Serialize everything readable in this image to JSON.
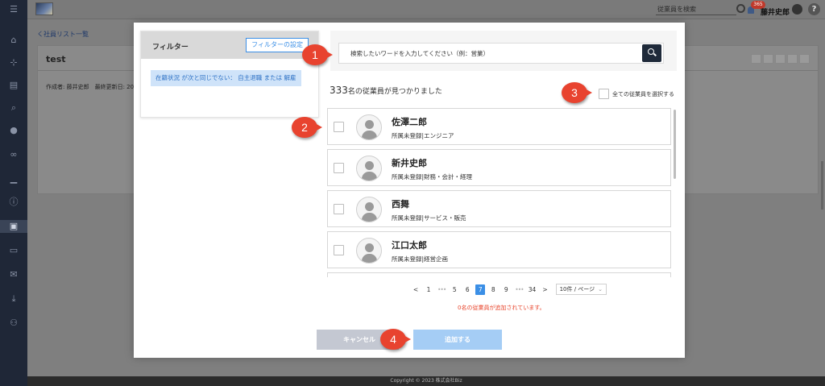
{
  "topbar": {
    "search_placeholder": "従業員を検索",
    "notification_count": "365",
    "user_name": "藤井史郎",
    "help_label": "?"
  },
  "background": {
    "back_link": "く社員リスト一覧",
    "page_title": "test",
    "meta": "作成者: 藤井史郎　最終更新日: 20",
    "footer": "Copyright © 2023 株式会社Biz"
  },
  "modal": {
    "filter": {
      "title": "フィルター",
      "setting_button": "フィルターの設定",
      "chip": "在籍状況 が次と同じでない： 自主退職 または 解雇"
    },
    "search": {
      "placeholder": "検索したいワードを入力してください（例：営業）"
    },
    "result": {
      "count": "333",
      "suffix": "名の従業員が見つかりました"
    },
    "select_all_label": "全ての従業員を選択する",
    "employees": [
      {
        "name": "佐澤二郎",
        "dept": "所属未登録|エンジニア"
      },
      {
        "name": "新井史郎",
        "dept": "所属未登録|財務・会計・経理"
      },
      {
        "name": "西舞",
        "dept": "所属未登録|サービス・販売"
      },
      {
        "name": "江口太郎",
        "dept": "所属未登録|経営企画"
      }
    ],
    "pagination": {
      "prev": "<",
      "pages": [
        "1",
        "•••",
        "5",
        "6",
        "7",
        "8",
        "9",
        "•••",
        "34"
      ],
      "active": "7",
      "next": ">",
      "page_size": "10件 / ページ"
    },
    "added_message": "0名の従業員が追加されています。",
    "cancel_button": "キャンセル",
    "add_button": "追加する"
  },
  "callouts": [
    "1",
    "2",
    "3",
    "4"
  ],
  "colors": {
    "primary": "#3b8fe6",
    "callout": "#e8432f",
    "search_button": "#1f2a3a",
    "error_text": "#e8452c"
  }
}
